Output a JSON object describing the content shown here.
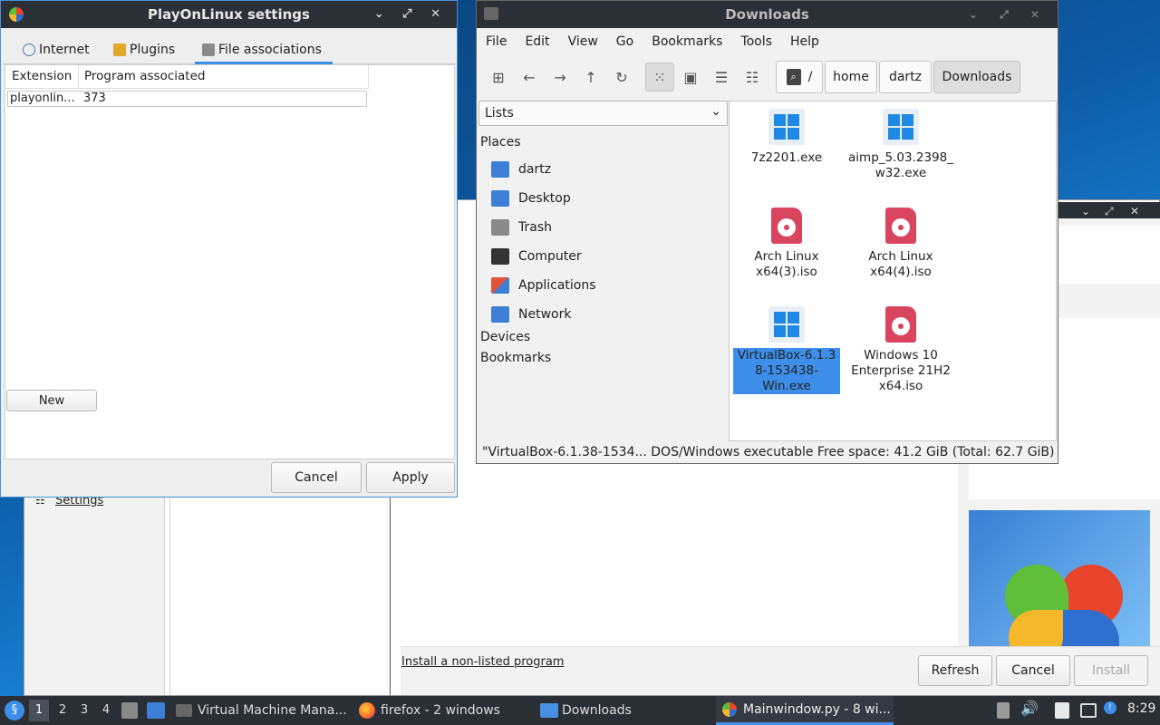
{
  "pol_settings": {
    "title": "PlayOnLinux settings",
    "window_controls": "⌄ ⤢ ✕",
    "tabs": [
      {
        "label": "Internet",
        "icon": "globe-icon"
      },
      {
        "label": "Plugins",
        "icon": "plugin-icon"
      },
      {
        "label": "File associations",
        "icon": "file-associations-icon",
        "active": true
      }
    ],
    "table": {
      "headers": [
        "Extension",
        "Program associated"
      ],
      "rows": [
        [
          "playonlin...",
          "373"
        ]
      ]
    },
    "new_label": "New",
    "cancel_label": "Cancel",
    "apply_label": "Apply"
  },
  "file_manager": {
    "title": "Downloads",
    "window_controls": "⌄ ⤢ ✕",
    "menu": [
      "File",
      "Edit",
      "View",
      "Go",
      "Bookmarks",
      "Tools",
      "Help"
    ],
    "breadcrumbs": [
      "/",
      "home",
      "dartz",
      "Downloads"
    ],
    "side_pane_mode": "Lists",
    "sections": {
      "places": "Places",
      "devices": "Devices",
      "bookmarks": "Bookmarks"
    },
    "places": [
      {
        "label": "dartz",
        "icon": "home-folder-icon",
        "color": "#3d7fd6"
      },
      {
        "label": "Desktop",
        "icon": "desktop-icon",
        "color": "#3d7fd6"
      },
      {
        "label": "Trash",
        "icon": "trash-icon",
        "color": "#8a8a8a"
      },
      {
        "label": "Computer",
        "icon": "computer-icon",
        "color": "#333333"
      },
      {
        "label": "Applications",
        "icon": "applications-icon",
        "color": "#e0533d"
      },
      {
        "label": "Network",
        "icon": "network-icon",
        "color": "#3d7fd6"
      }
    ],
    "files": [
      {
        "name": "7z2201.exe",
        "icon": "windows-exe-icon"
      },
      {
        "name": "aimp_5.03.2398_ w32.exe",
        "icon": "windows-exe-icon"
      },
      {
        "name": "Arch Linux x64(3).iso",
        "icon": "disc-image-icon"
      },
      {
        "name": "Arch Linux x64(4).iso",
        "icon": "disc-image-icon"
      },
      {
        "name": "VirtualBox-6.1.3 8-153438- Win.exe",
        "icon": "windows-exe-icon",
        "selected": true
      },
      {
        "name": "Windows 10 Enterprise 21H2 x64.iso",
        "icon": "disc-image-icon"
      }
    ],
    "status": "\"VirtualBox-6.1.38-1534... DOS/Windows executable   Free space: 41.2 GiB (Total: 62.7 GiB)",
    "selection_color": "#3d8ee8"
  },
  "pol_main": {
    "settings_label": "Settings",
    "install_link": "Install a non-listed program",
    "refresh_label": "Refresh",
    "cancel_label": "Cancel",
    "install_label": "Install"
  },
  "taskbar": {
    "workspaces": [
      "1",
      "2",
      "3",
      "4"
    ],
    "tasks": [
      {
        "label": "Virtual Machine Mana...",
        "icon": "virt-manager-icon"
      },
      {
        "label": "firefox - 2 windows",
        "icon": "firefox-icon"
      },
      {
        "label": "Downloads",
        "icon": "folder-icon"
      },
      {
        "label": "Mainwindow.py - 8 wi...",
        "icon": "playonlinux-icon",
        "active": true
      }
    ],
    "clock": "8:29",
    "accent": "#3d8ee8"
  }
}
